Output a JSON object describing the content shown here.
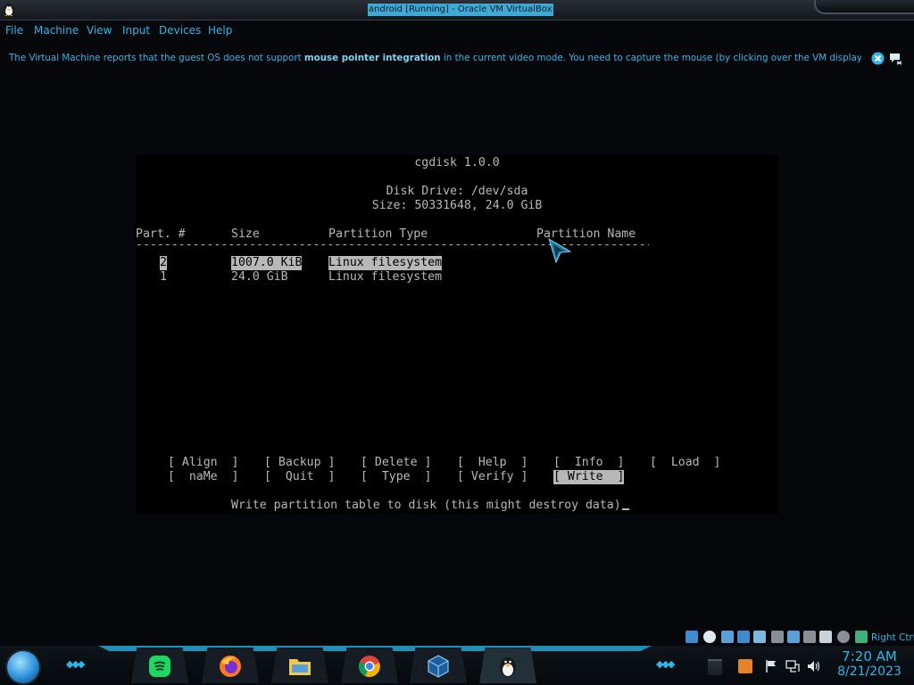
{
  "window": {
    "title": "android [Running] - Oracle VM VirtualBox"
  },
  "menu": [
    "File",
    "Machine",
    "View",
    "Input",
    "Devices",
    "Help"
  ],
  "notification": {
    "text_before": "The Virtual Machine reports that the guest OS does not support ",
    "text_bold": "mouse pointer integration",
    "text_after": " in the current video mode. You need to capture the mouse (by clicking over the VM display or pressing"
  },
  "terminal": {
    "app_title": "cgdisk 1.0.0",
    "disk_drive": "Disk Drive: /dev/sda",
    "size_line": "Size: 50331648, 24.0 GiB",
    "columns": {
      "part": "Part. #",
      "size": "Size",
      "type": "Partition Type",
      "name": "Partition Name"
    },
    "separator": "----------------------------------------------------------------------------------------------------------------------",
    "rows": [
      {
        "part": "2",
        "size": "1007.0 KiB",
        "type": "Linux filesystem",
        "name": ""
      },
      {
        "part": "1",
        "size": "24.0 GiB",
        "type": "Linux filesystem",
        "name": ""
      }
    ],
    "menu_row1": [
      "[ Align  ]",
      "[ Backup ]",
      "[ Delete ]",
      "[  Help  ]",
      "[  Info  ]",
      "[  Load  ]"
    ],
    "menu_row2": [
      "[  naMe  ]",
      "[  Quit  ]",
      "[  Type  ]",
      "[ Verify ]",
      "[ Write  ]"
    ],
    "selected_action": "[ Write  ]",
    "status_line": "Write partition table to disk (this might destroy data)"
  },
  "statusbar": {
    "host_key": "Right Ctrl"
  },
  "taskbar": {
    "apps": [
      "spotify",
      "firefox",
      "file-manager",
      "chrome",
      "virtualbox",
      "linux-vm"
    ],
    "time": "7:20 AM",
    "date": "8/21/2023"
  },
  "colors": {
    "accent": "#2fb6e8",
    "terminal_text": "#b8b8b8",
    "terminal_bg": "#000000"
  }
}
